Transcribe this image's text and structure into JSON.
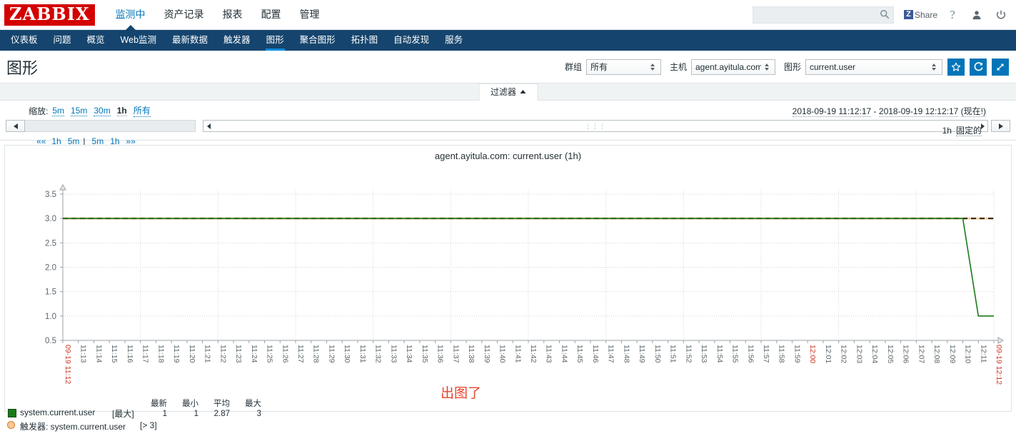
{
  "header": {
    "logo": "ZABBIX",
    "main_menu": [
      {
        "label": "监测中",
        "selected": true
      },
      {
        "label": "资产记录",
        "selected": false
      },
      {
        "label": "报表",
        "selected": false
      },
      {
        "label": "配置",
        "selected": false
      },
      {
        "label": "管理",
        "selected": false
      }
    ],
    "search_value": "",
    "search_placeholder": "",
    "share_label": "Share",
    "share_badge": "Z"
  },
  "subnav": {
    "items": [
      {
        "label": "仪表板",
        "selected": false
      },
      {
        "label": "问题",
        "selected": false
      },
      {
        "label": "概览",
        "selected": false
      },
      {
        "label": "Web监测",
        "selected": false
      },
      {
        "label": "最新数据",
        "selected": false
      },
      {
        "label": "触发器",
        "selected": false
      },
      {
        "label": "图形",
        "selected": true
      },
      {
        "label": "聚合图形",
        "selected": false
      },
      {
        "label": "拓扑图",
        "selected": false
      },
      {
        "label": "自动发现",
        "selected": false
      },
      {
        "label": "服务",
        "selected": false
      }
    ]
  },
  "page": {
    "title": "图形"
  },
  "filters": {
    "group_label": "群组",
    "group_value": "所有",
    "host_label": "主机",
    "host_value": "agent.ayitula.com",
    "graph_label": "图形",
    "graph_value": "current.user"
  },
  "filter_tab": {
    "label": "过滤器"
  },
  "time": {
    "zoom_label": "缩放:",
    "zoom_options": [
      {
        "label": "5m",
        "active": false
      },
      {
        "label": "15m",
        "active": false
      },
      {
        "label": "30m",
        "active": false
      },
      {
        "label": "1h",
        "active": true
      },
      {
        "label": "所有",
        "active": false
      }
    ],
    "range_from": "2018-09-19 11:12:17",
    "range_dash": " - ",
    "range_to": "2018-09-19 12:12:17",
    "range_now": "(现在!)",
    "nav_first": "««",
    "nav_back_1h": "1h",
    "nav_back_5m": "5m",
    "nav_sep": "|",
    "nav_fwd_5m": "5m",
    "nav_fwd_1h": "1h",
    "nav_last": "»»",
    "period": "1h",
    "fixed_label": "固定的"
  },
  "chart_data": {
    "type": "line",
    "title": "agent.ayitula.com: current.user (1h)",
    "xlabel": "",
    "ylabel": "",
    "ylim": [
      0.5,
      3.5
    ],
    "yticks": [
      0.5,
      1.0,
      1.5,
      2.0,
      2.5,
      3.0,
      3.5
    ],
    "ytick_labels": [
      "0.5",
      "1.0",
      "1.5",
      "2.0",
      "2.5",
      "3.0",
      "3.5"
    ],
    "grid": true,
    "legend_position": "bottom-left",
    "xtick_labels": [
      "09-19 11:12",
      "11:13",
      "11:14",
      "11:15",
      "11:16",
      "11:17",
      "11:18",
      "11:19",
      "11:20",
      "11:21",
      "11:22",
      "11:23",
      "11:24",
      "11:25",
      "11:26",
      "11:27",
      "11:28",
      "11:29",
      "11:30",
      "11:31",
      "11:32",
      "11:33",
      "11:34",
      "11:35",
      "11:36",
      "11:37",
      "11:38",
      "11:39",
      "11:40",
      "11:41",
      "11:42",
      "11:43",
      "11:44",
      "11:45",
      "11:46",
      "11:47",
      "11:48",
      "11:49",
      "11:50",
      "11:51",
      "11:52",
      "11:53",
      "11:54",
      "11:55",
      "11:56",
      "11:57",
      "11:58",
      "11:59",
      "12:00",
      "12:01",
      "12:02",
      "12:03",
      "12:04",
      "12:05",
      "12:06",
      "12:07",
      "12:08",
      "12:09",
      "12:10",
      "12:11",
      "09-19 12:12"
    ],
    "xtick_highlight": [
      0,
      48,
      60
    ],
    "series": [
      {
        "name": "system.current.user",
        "color": "#1a7a1a",
        "aggregate": "[最大]",
        "x": [
          0,
          1,
          2,
          3,
          4,
          5,
          6,
          7,
          8,
          9,
          10,
          11,
          12,
          13,
          14,
          15,
          16,
          17,
          18,
          19,
          20,
          21,
          22,
          23,
          24,
          25,
          26,
          27,
          28,
          29,
          30,
          31,
          32,
          33,
          34,
          35,
          36,
          37,
          38,
          39,
          40,
          41,
          42,
          43,
          44,
          45,
          46,
          47,
          48,
          49,
          50,
          51,
          52,
          53,
          54,
          55,
          56,
          57,
          58,
          59,
          60
        ],
        "values": [
          3,
          3,
          3,
          3,
          3,
          3,
          3,
          3,
          3,
          3,
          3,
          3,
          3,
          3,
          3,
          3,
          3,
          3,
          3,
          3,
          3,
          3,
          3,
          3,
          3,
          3,
          3,
          3,
          3,
          3,
          3,
          3,
          3,
          3,
          3,
          3,
          3,
          3,
          3,
          3,
          3,
          3,
          3,
          3,
          3,
          3,
          3,
          3,
          3,
          3,
          3,
          3,
          3,
          3,
          3,
          3,
          3,
          3,
          3,
          1,
          1
        ]
      }
    ],
    "trigger": {
      "name": "触发器: system.current.user",
      "expression": "[> 3]",
      "color": "#d97b1f",
      "value": 3
    },
    "annotation": "出图了",
    "annotation_color": "#e8432b",
    "stats_headers": [
      "最新",
      "最小",
      "平均",
      "最大"
    ],
    "stats_values": [
      "1",
      "1",
      "2.87",
      "3"
    ]
  }
}
